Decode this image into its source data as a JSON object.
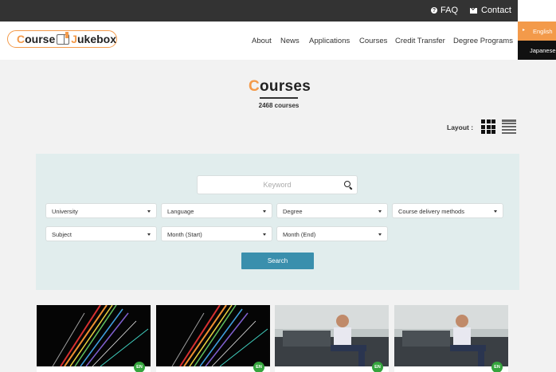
{
  "topbar": {
    "faq": "FAQ",
    "contact": "Contact"
  },
  "header": {
    "logo": {
      "c": "C",
      "ourse": "ourse",
      "jukebox": "ukebox",
      "j": "J"
    },
    "nav": [
      "About",
      "News",
      "Applications",
      "Courses",
      "Credit Transfer",
      "Degree Programs"
    ]
  },
  "language": {
    "english": "English",
    "japanese": "Japanese"
  },
  "main": {
    "title_first": "C",
    "title_rest": "ourses",
    "count": "2468 courses",
    "layout_label": "Layout :"
  },
  "search": {
    "keyword_placeholder": "Keyword",
    "row1": [
      "University",
      "Language",
      "Degree",
      "Course delivery methods"
    ],
    "row2": [
      "Subject",
      "Month (Start)",
      "Month (End)"
    ],
    "button": "Search"
  },
  "cards": [
    {
      "badge": "EN",
      "image": "abstract-lines"
    },
    {
      "badge": "EN",
      "image": "abstract-lines"
    },
    {
      "badge": "EN",
      "image": "man-on-couch"
    },
    {
      "badge": "EN",
      "image": "man-on-couch"
    }
  ]
}
